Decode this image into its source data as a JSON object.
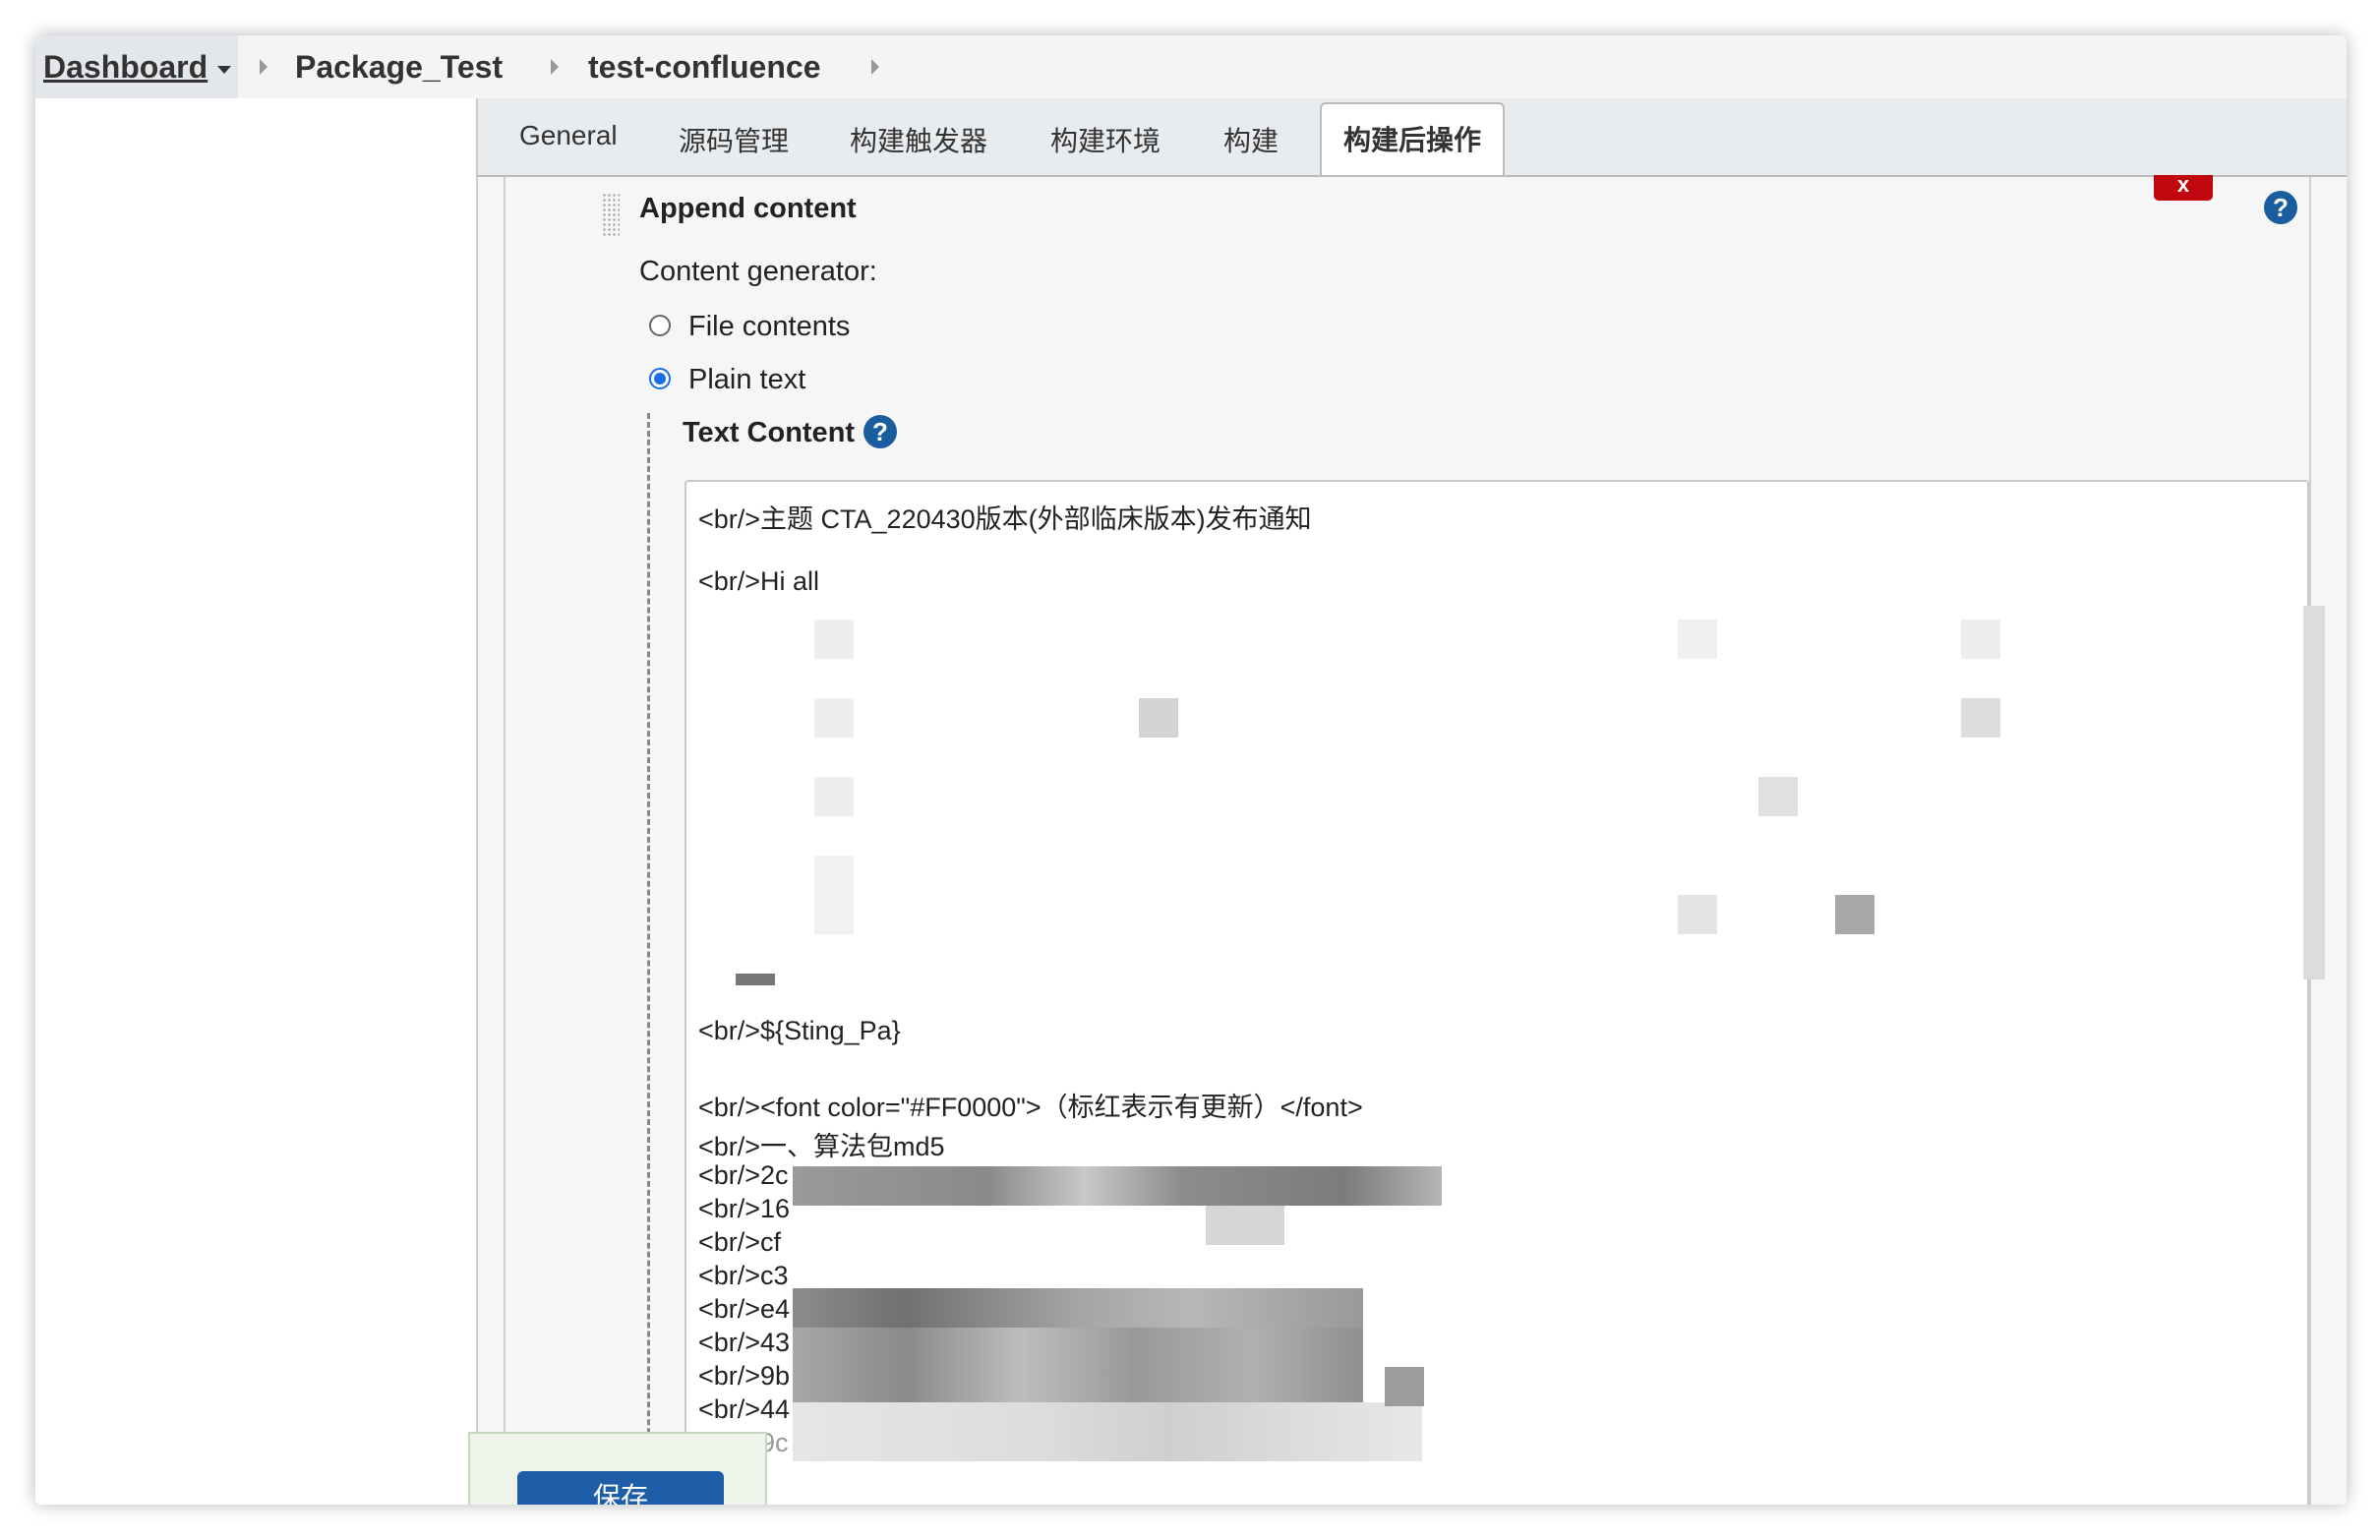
{
  "breadcrumb": {
    "items": [
      "Dashboard",
      "Package_Test",
      "test-confluence"
    ]
  },
  "tabs": [
    "General",
    "源码管理",
    "构建触发器",
    "构建环境",
    "构建",
    "构建后操作"
  ],
  "active_tab": "构建后操作",
  "section": {
    "title": "Append content",
    "delete_label": "x",
    "content_generator_label": "Content generator:",
    "options": [
      "File contents",
      "Plain text"
    ],
    "selected_option": "Plain text",
    "text_content_label": "Text Content",
    "help_label": "?"
  },
  "textarea_lines": {
    "l1": "<br/>主题 CTA_220430版本(外部临床版本)发布通知",
    "l2": "<br/>Hi all",
    "l3": "<br/>${Sting_Pa}",
    "l4": "<br/><font color=\"#FF0000\">（标红表示有更新）</font>",
    "l5": "<br/>一、算法包md5",
    "l6": "<br/>2c",
    "l7": "<br/>16",
    "l8": "<br/>cf",
    "l9": "<br/>c3",
    "l10": "<br/>e4",
    "l11": "<br/>43",
    "l12": "<br/>9b",
    "l13": "<br/>44",
    "l14": "<br/>9c"
  },
  "footer": {
    "save_label": "保存"
  },
  "colors": {
    "accent_blue": "#1a5d9e",
    "delete_red": "#c0070d",
    "radio_blue": "#1b6ee8"
  }
}
